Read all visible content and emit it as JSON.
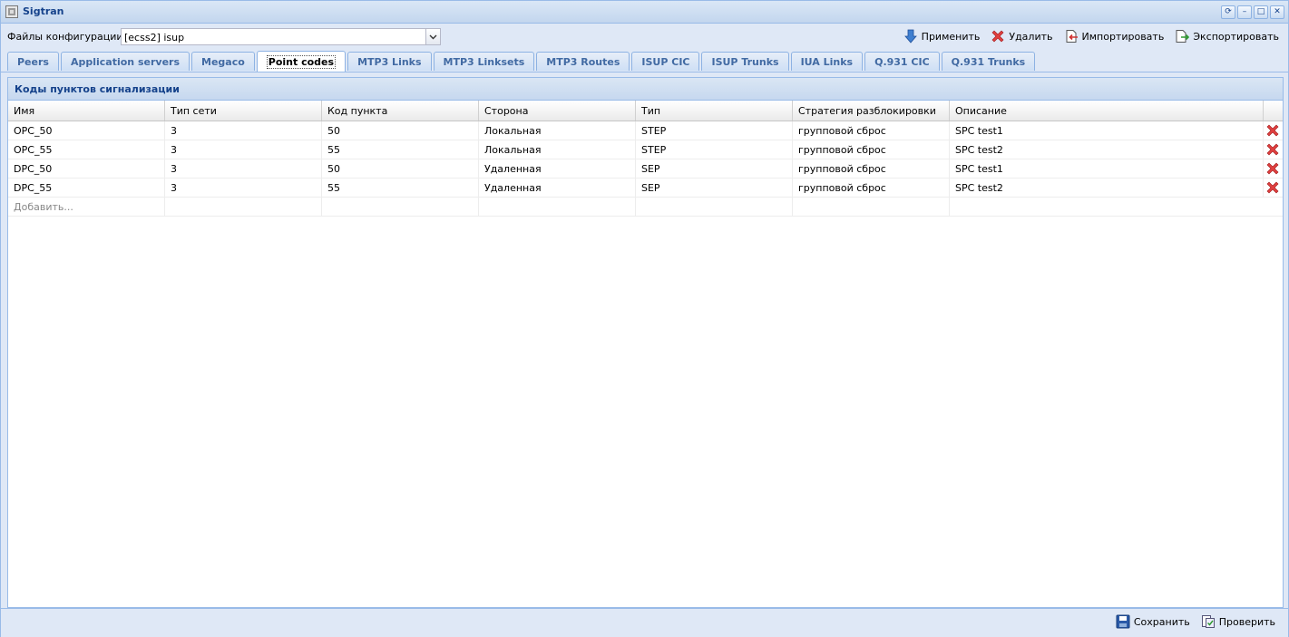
{
  "window": {
    "title": "Sigtran"
  },
  "config": {
    "label": "Файлы конфигурации:",
    "value": "[ecss2] isup"
  },
  "actions": {
    "apply": "Применить",
    "delete": "Удалить",
    "import": "Импортировать",
    "export": "Экспортировать"
  },
  "tabs": [
    {
      "label": "Peers"
    },
    {
      "label": "Application servers"
    },
    {
      "label": "Megaco"
    },
    {
      "label": "Point codes"
    },
    {
      "label": "MTP3 Links"
    },
    {
      "label": "MTP3 Linksets"
    },
    {
      "label": "MTP3 Routes"
    },
    {
      "label": "ISUP CIC"
    },
    {
      "label": "ISUP Trunks"
    },
    {
      "label": "IUA Links"
    },
    {
      "label": "Q.931 CIC"
    },
    {
      "label": "Q.931 Trunks"
    }
  ],
  "panel": {
    "title": "Коды пунктов сигнализации"
  },
  "columns": [
    "Имя",
    "Тип сети",
    "Код пункта",
    "Сторона",
    "Тип",
    "Стратегия разблокировки",
    "Описание"
  ],
  "rows": [
    [
      "OPC_50",
      "3",
      "50",
      "Локальная",
      "STEP",
      "групповой сброс",
      "SPC test1"
    ],
    [
      "OPC_55",
      "3",
      "55",
      "Локальная",
      "STEP",
      "групповой сброс",
      "SPC test2"
    ],
    [
      "DPC_50",
      "3",
      "50",
      "Удаленная",
      "SEP",
      "групповой сброс",
      "SPC test1"
    ],
    [
      "DPC_55",
      "3",
      "55",
      "Удаленная",
      "SEP",
      "групповой сброс",
      "SPC test2"
    ]
  ],
  "add_row": {
    "label": "Добавить..."
  },
  "bottom": {
    "save": "Сохранить",
    "check": "Проверить"
  },
  "colors": {
    "accent": "#15428b",
    "border": "#99bbe8",
    "delete": "#cc2222"
  }
}
